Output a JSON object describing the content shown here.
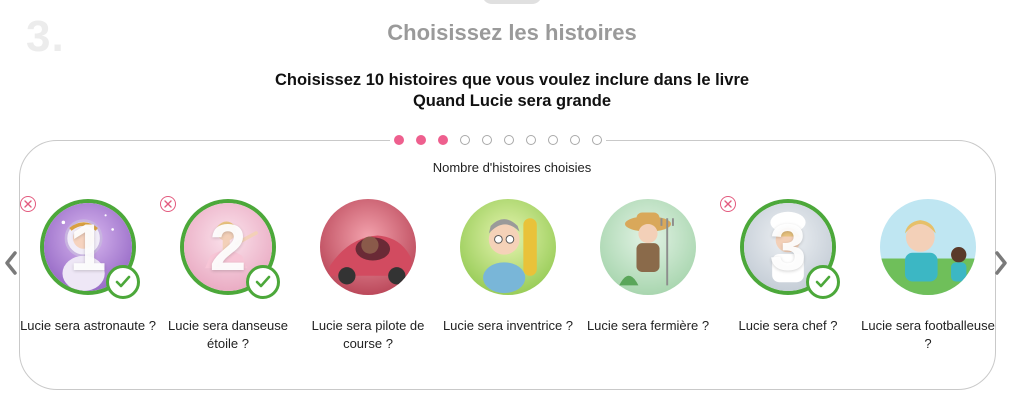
{
  "step": {
    "number": "3.",
    "title": "Choisissez les histoires"
  },
  "instruction": {
    "line1": "Choisissez 10 histoires que vous voulez inclure dans le livre",
    "line2": "Quand Lucie sera grande"
  },
  "progress": {
    "selected": 3,
    "total": 10,
    "filled_color": "#ee5f8e",
    "empty_color": "#a9a9a9"
  },
  "selection_label": "Nombre d'histoires choisies",
  "accent_color": "#4ca83a",
  "nav": {
    "prev_icon": "chevron-left-icon",
    "next_icon": "chevron-right-icon"
  },
  "stories": [
    {
      "title": "Lucie sera astronaute ?",
      "selected": true,
      "order": "1",
      "theme": "astronaut"
    },
    {
      "title": "Lucie sera danseuse étoile ?",
      "selected": true,
      "order": "2",
      "theme": "dancer"
    },
    {
      "title": "Lucie sera pilote de course ?",
      "selected": false,
      "order": "",
      "theme": "race-driver"
    },
    {
      "title": "Lucie sera inventrice ?",
      "selected": false,
      "order": "",
      "theme": "inventor"
    },
    {
      "title": "Lucie sera fermière ?",
      "selected": false,
      "order": "",
      "theme": "farmer"
    },
    {
      "title": "Lucie sera chef ?",
      "selected": true,
      "order": "3",
      "theme": "chef"
    },
    {
      "title": "Lucie sera footballeuse ?",
      "selected": false,
      "order": "",
      "theme": "football"
    }
  ]
}
